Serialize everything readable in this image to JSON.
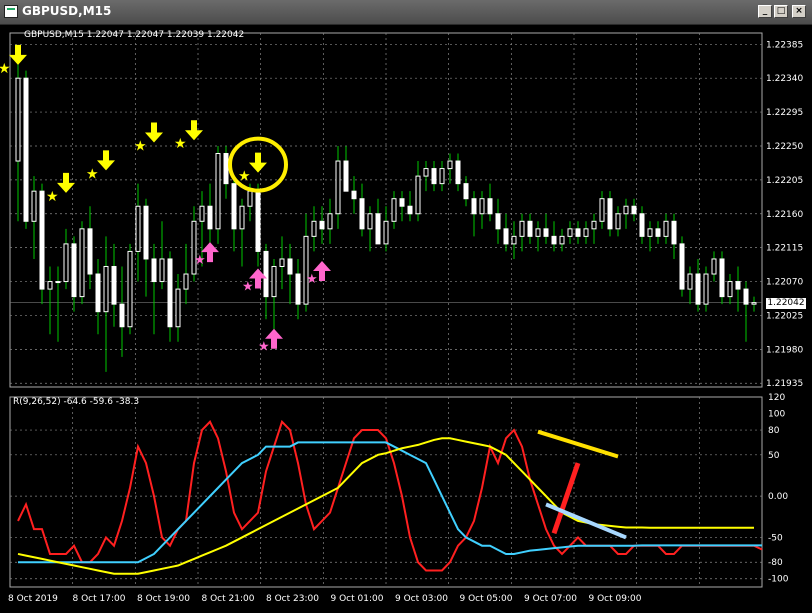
{
  "window": {
    "title": "GBPUSD,M15",
    "min_label": "_",
    "max_label": "□",
    "close_label": "×"
  },
  "main_info": "GBPUSD,M15  1.22047 1.22047 1.22039 1.22042",
  "indicator_info": "R(9,26,52) -64.6 -59.6 -38.3",
  "current_price": "1.22042",
  "price_axis": [
    "1.22385",
    "1.22340",
    "1.22295",
    "1.22250",
    "1.22205",
    "1.22160",
    "1.22115",
    "1.22070",
    "1.22025",
    "1.21980",
    "1.21935"
  ],
  "indicator_axis": [
    "120",
    "100",
    "80",
    "50",
    "0.00",
    "-50",
    "-80",
    "-100"
  ],
  "time_labels": [
    "8 Oct 2019",
    "8 Oct 17:00",
    "8 Oct 19:00",
    "8 Oct 21:00",
    "8 Oct 23:00",
    "9 Oct 01:00",
    "9 Oct 03:00",
    "9 Oct 05:00",
    "9 Oct 07:00",
    "9 Oct 09:00"
  ],
  "colors": {
    "bull": "#ffffff",
    "bear": "#ffffff",
    "wick": "#00c800",
    "grid": "#888888",
    "red_line": "#ff2020",
    "cyan_line": "#40d0ff",
    "yellow_line": "#ffff00",
    "sell_arrow": "#ffff00",
    "buy_arrow": "#ff66cc"
  },
  "chart_data": {
    "type": "candlestick",
    "symbol": "GBPUSD",
    "timeframe": "M15",
    "ylim": [
      1.2193,
      1.224
    ],
    "candles": [
      [
        1.2223,
        1.2236,
        1.2215,
        1.2234
      ],
      [
        1.2234,
        1.2235,
        1.2214,
        1.2215
      ],
      [
        1.2215,
        1.2221,
        1.221,
        1.2219
      ],
      [
        1.2219,
        1.222,
        1.2204,
        1.2206
      ],
      [
        1.2206,
        1.2209,
        1.22,
        1.2207
      ],
      [
        1.2207,
        1.2209,
        1.2199,
        1.2207
      ],
      [
        1.2207,
        1.2214,
        1.2206,
        1.2212
      ],
      [
        1.2212,
        1.2213,
        1.2203,
        1.2205
      ],
      [
        1.2205,
        1.2215,
        1.2204,
        1.2214
      ],
      [
        1.2214,
        1.2217,
        1.2206,
        1.2208
      ],
      [
        1.2208,
        1.221,
        1.22,
        1.2203
      ],
      [
        1.2203,
        1.2213,
        1.2195,
        1.2209
      ],
      [
        1.2209,
        1.2212,
        1.2201,
        1.2204
      ],
      [
        1.2204,
        1.2209,
        1.2197,
        1.2201
      ],
      [
        1.2201,
        1.2212,
        1.22,
        1.2211
      ],
      [
        1.2211,
        1.222,
        1.2207,
        1.2217
      ],
      [
        1.2217,
        1.2218,
        1.2205,
        1.221
      ],
      [
        1.221,
        1.2212,
        1.22,
        1.2207
      ],
      [
        1.2207,
        1.2215,
        1.2206,
        1.221
      ],
      [
        1.221,
        1.2211,
        1.2199,
        1.2201
      ],
      [
        1.2201,
        1.2208,
        1.2199,
        1.2206
      ],
      [
        1.2206,
        1.2212,
        1.2204,
        1.2208
      ],
      [
        1.2208,
        1.2217,
        1.2207,
        1.2215
      ],
      [
        1.2215,
        1.2219,
        1.2209,
        1.2217
      ],
      [
        1.2217,
        1.222,
        1.2211,
        1.2214
      ],
      [
        1.2214,
        1.2225,
        1.2212,
        1.2224
      ],
      [
        1.2224,
        1.2225,
        1.2218,
        1.222
      ],
      [
        1.222,
        1.2221,
        1.2211,
        1.2214
      ],
      [
        1.2214,
        1.2218,
        1.2209,
        1.2217
      ],
      [
        1.2217,
        1.222,
        1.2215,
        1.2219
      ],
      [
        1.2219,
        1.222,
        1.2209,
        1.2211
      ],
      [
        1.2211,
        1.2212,
        1.2202,
        1.2205
      ],
      [
        1.2205,
        1.221,
        1.22,
        1.2209
      ],
      [
        1.2209,
        1.2213,
        1.2206,
        1.221
      ],
      [
        1.221,
        1.2212,
        1.2204,
        1.2208
      ],
      [
        1.2208,
        1.221,
        1.2202,
        1.2204
      ],
      [
        1.2204,
        1.2216,
        1.2203,
        1.2213
      ],
      [
        1.2213,
        1.2217,
        1.2211,
        1.2215
      ],
      [
        1.2215,
        1.2217,
        1.2212,
        1.2214
      ],
      [
        1.2214,
        1.2218,
        1.2212,
        1.2216
      ],
      [
        1.2216,
        1.2225,
        1.2214,
        1.2223
      ],
      [
        1.2223,
        1.2225,
        1.2219,
        1.2219
      ],
      [
        1.2219,
        1.2221,
        1.2216,
        1.2218
      ],
      [
        1.2218,
        1.222,
        1.2213,
        1.2214
      ],
      [
        1.2214,
        1.2217,
        1.2211,
        1.2216
      ],
      [
        1.2216,
        1.2218,
        1.2212,
        1.2212
      ],
      [
        1.2212,
        1.2217,
        1.2211,
        1.2215
      ],
      [
        1.2215,
        1.2219,
        1.2214,
        1.2218
      ],
      [
        1.2218,
        1.2219,
        1.2215,
        1.2217
      ],
      [
        1.2217,
        1.2219,
        1.2215,
        1.2216
      ],
      [
        1.2216,
        1.2223,
        1.2215,
        1.2221
      ],
      [
        1.2221,
        1.2223,
        1.2219,
        1.2222
      ],
      [
        1.2222,
        1.2223,
        1.2219,
        1.222
      ],
      [
        1.222,
        1.2223,
        1.2219,
        1.2222
      ],
      [
        1.2222,
        1.2224,
        1.222,
        1.2223
      ],
      [
        1.2223,
        1.2224,
        1.2219,
        1.222
      ],
      [
        1.222,
        1.2221,
        1.2217,
        1.2218
      ],
      [
        1.2218,
        1.2219,
        1.2213,
        1.2216
      ],
      [
        1.2216,
        1.2219,
        1.2214,
        1.2218
      ],
      [
        1.2218,
        1.222,
        1.2215,
        1.2216
      ],
      [
        1.2216,
        1.2218,
        1.2212,
        1.2214
      ],
      [
        1.2214,
        1.2216,
        1.2211,
        1.2212
      ],
      [
        1.2212,
        1.2215,
        1.221,
        1.2213
      ],
      [
        1.2213,
        1.2216,
        1.2211,
        1.2215
      ],
      [
        1.2215,
        1.2216,
        1.2212,
        1.2213
      ],
      [
        1.2213,
        1.2215,
        1.2211,
        1.2214
      ],
      [
        1.2214,
        1.2216,
        1.2212,
        1.2213
      ],
      [
        1.2213,
        1.2215,
        1.2211,
        1.2212
      ],
      [
        1.2212,
        1.2214,
        1.2211,
        1.2213
      ],
      [
        1.2213,
        1.2215,
        1.2212,
        1.2214
      ],
      [
        1.2214,
        1.2215,
        1.2212,
        1.2213
      ],
      [
        1.2213,
        1.2215,
        1.2212,
        1.2214
      ],
      [
        1.2214,
        1.2216,
        1.2212,
        1.2215
      ],
      [
        1.2215,
        1.2219,
        1.2214,
        1.2218
      ],
      [
        1.2218,
        1.2219,
        1.2213,
        1.2214
      ],
      [
        1.2214,
        1.2217,
        1.2213,
        1.2216
      ],
      [
        1.2216,
        1.2218,
        1.2214,
        1.2217
      ],
      [
        1.2217,
        1.2218,
        1.2215,
        1.2216
      ],
      [
        1.2216,
        1.2217,
        1.2212,
        1.2213
      ],
      [
        1.2213,
        1.2215,
        1.2211,
        1.2214
      ],
      [
        1.2214,
        1.2215,
        1.2212,
        1.2213
      ],
      [
        1.2213,
        1.2216,
        1.2212,
        1.2215
      ],
      [
        1.2215,
        1.2216,
        1.221,
        1.2212
      ],
      [
        1.2212,
        1.2213,
        1.2205,
        1.2206
      ],
      [
        1.2206,
        1.2209,
        1.2204,
        1.2208
      ],
      [
        1.2208,
        1.221,
        1.2203,
        1.2204
      ],
      [
        1.2204,
        1.2209,
        1.2203,
        1.2208
      ],
      [
        1.2208,
        1.2211,
        1.2207,
        1.221
      ],
      [
        1.221,
        1.2211,
        1.2204,
        1.2205
      ],
      [
        1.2205,
        1.2208,
        1.2204,
        1.2207
      ],
      [
        1.2207,
        1.2209,
        1.2203,
        1.2206
      ],
      [
        1.2206,
        1.2207,
        1.2199,
        1.2204
      ],
      [
        1.2204,
        1.2205,
        1.2203,
        1.22042
      ]
    ],
    "sell_signals": [
      [
        0,
        1.22355
      ],
      [
        6,
        1.22185
      ],
      [
        11,
        1.22215
      ],
      [
        17,
        1.22252
      ],
      [
        22,
        1.22255
      ],
      [
        30,
        1.22212
      ]
    ],
    "buy_signals": [
      [
        24,
        1.22125
      ],
      [
        30,
        1.2209
      ],
      [
        32,
        1.2201
      ],
      [
        38,
        1.221
      ]
    ],
    "indicator": {
      "name": "R(9,26,52)",
      "ylim": [
        -110,
        120
      ],
      "series": [
        {
          "name": "fast",
          "values": [
            -30,
            -10,
            -40,
            -40,
            -70,
            -70,
            -70,
            -60,
            -80,
            -80,
            -70,
            -50,
            -60,
            -30,
            10,
            60,
            40,
            0,
            -50,
            -60,
            -40,
            -30,
            40,
            80,
            90,
            70,
            30,
            -20,
            -40,
            -30,
            -20,
            30,
            60,
            90,
            80,
            40,
            -10,
            -40,
            -30,
            -20,
            10,
            40,
            70,
            80,
            80,
            80,
            70,
            40,
            0,
            -50,
            -80,
            -90,
            -90,
            -90,
            -80,
            -60,
            -50,
            -30,
            10,
            60,
            40,
            70,
            80,
            60,
            20,
            -10,
            -40,
            -60,
            -70,
            -60,
            -50,
            -60,
            -60,
            -60,
            -60,
            -70,
            -70,
            -60,
            -60,
            -60,
            -60,
            -70,
            -70,
            -60,
            -60,
            -60,
            -60,
            -60,
            -60,
            -60,
            -60,
            -60,
            -60,
            -64.6
          ]
        },
        {
          "name": "medium",
          "values": [
            -80,
            -80,
            -80,
            -80,
            -80,
            -80,
            -80,
            -80,
            -80,
            -80,
            -80,
            -80,
            -80,
            -80,
            -80,
            -80,
            -75,
            -70,
            -60,
            -50,
            -40,
            -30,
            -20,
            -10,
            0,
            10,
            20,
            30,
            40,
            45,
            50,
            60,
            60,
            60,
            60,
            65,
            65,
            65,
            65,
            65,
            65,
            65,
            65,
            65,
            65,
            65,
            65,
            60,
            55,
            50,
            45,
            40,
            20,
            0,
            -20,
            -40,
            -50,
            -55,
            -60,
            -60,
            -65,
            -70,
            -70,
            -68,
            -66,
            -65,
            -64,
            -63,
            -62,
            -61,
            -60,
            -60,
            -60,
            -60,
            -60,
            -60,
            -60,
            -60,
            -59.6,
            -59.6,
            -59.6,
            -59.6,
            -59.6,
            -59.6,
            -59.6,
            -59.6,
            -59.6,
            -59.6,
            -59.6,
            -59.6,
            -59.6,
            -59.6,
            -59.6,
            -59.6
          ]
        },
        {
          "name": "slow",
          "values": [
            -70,
            -72,
            -74,
            -76,
            -78,
            -80,
            -82,
            -84,
            -86,
            -88,
            -90,
            -92,
            -94,
            -94,
            -94,
            -94,
            -92,
            -90,
            -88,
            -86,
            -84,
            -80,
            -76,
            -72,
            -68,
            -64,
            -60,
            -55,
            -50,
            -45,
            -40,
            -35,
            -30,
            -25,
            -20,
            -15,
            -10,
            -5,
            0,
            5,
            10,
            20,
            30,
            40,
            45,
            50,
            52,
            55,
            58,
            60,
            62,
            65,
            68,
            70,
            70,
            68,
            66,
            64,
            62,
            60,
            55,
            50,
            40,
            30,
            20,
            10,
            0,
            -10,
            -20,
            -25,
            -30,
            -32,
            -34,
            -35,
            -36,
            -37,
            -38,
            -38,
            -38,
            -38.3,
            -38.3,
            -38.3,
            -38.3,
            -38.3,
            -38.3,
            -38.3,
            -38.3,
            -38.3,
            -38.3,
            -38.3,
            -38.3,
            -38.3,
            -38.3
          ]
        }
      ]
    }
  }
}
